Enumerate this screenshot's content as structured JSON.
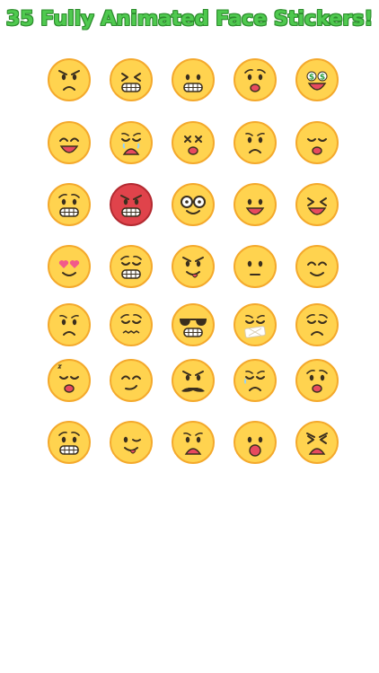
{
  "headline": "35 Fully Animated Face Stickers!",
  "colors": {
    "face": "#ffd34f",
    "face_edge": "#f4a92c",
    "angry_face": "#e0434b",
    "ink": "#3b2f1e",
    "mouth": "#e84a5f",
    "headline_green": "#4fc94f"
  },
  "stickers": [
    {
      "name": "angry-frown-face-icon"
    },
    {
      "name": "grinning-squint-face-icon"
    },
    {
      "name": "grimacing-face-icon"
    },
    {
      "name": "surprised-worried-face-icon"
    },
    {
      "name": "money-eyes-face-icon"
    },
    {
      "name": "happy-open-mouth-face-icon"
    },
    {
      "name": "crying-face-icon"
    },
    {
      "name": "dizzy-x-eyes-face-icon"
    },
    {
      "name": "sad-frown-face-icon"
    },
    {
      "name": "woozy-sick-face-icon"
    },
    {
      "name": "nervous-teeth-face-icon"
    },
    {
      "name": "red-angry-face-icon"
    },
    {
      "name": "nerd-glasses-face-icon"
    },
    {
      "name": "laughing-face-icon"
    },
    {
      "name": "squint-laugh-face-icon"
    },
    {
      "name": "heart-eyes-face-icon"
    },
    {
      "name": "anxious-teeth-face-icon"
    },
    {
      "name": "smirk-tongue-face-icon"
    },
    {
      "name": "neutral-face-icon"
    },
    {
      "name": "relieved-smile-face-icon"
    },
    {
      "name": "frowning-face-icon"
    },
    {
      "name": "confounded-face-icon"
    },
    {
      "name": "sunglasses-grin-face-icon"
    },
    {
      "name": "bandage-mouth-face-icon"
    },
    {
      "name": "pensive-face-icon"
    },
    {
      "name": "sleepy-yawn-face-icon"
    },
    {
      "name": "smirk-face-icon"
    },
    {
      "name": "mustache-face-icon"
    },
    {
      "name": "sweat-sad-face-icon"
    },
    {
      "name": "shocked-face-icon"
    },
    {
      "name": "scared-teeth-face-icon"
    },
    {
      "name": "winking-tongue-face-icon"
    },
    {
      "name": "worried-open-mouth-face-icon"
    },
    {
      "name": "amazed-face-icon"
    },
    {
      "name": "furious-yelling-face-icon"
    }
  ]
}
